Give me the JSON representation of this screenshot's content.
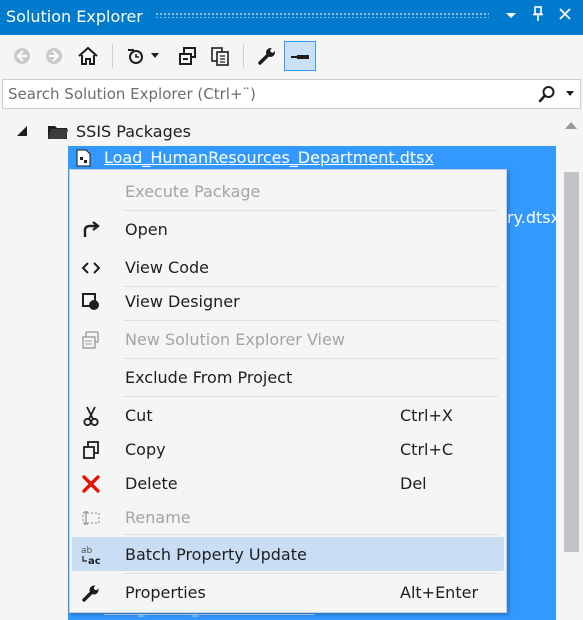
{
  "window": {
    "title": "Solution Explorer",
    "dropdown_icon": "dropdown-arrow-icon",
    "pin_icon": "pin-icon",
    "close_icon": "close-icon"
  },
  "toolbar": {
    "buttons": [
      "back-icon",
      "forward-icon",
      "home-icon",
      "pending-changes-icon",
      "collapse-all-icon",
      "show-all-files-icon",
      "properties-wrench-icon",
      "preview-selected-icon"
    ]
  },
  "search": {
    "placeholder": "Search Solution Explorer (Ctrl+¨)",
    "value": ""
  },
  "tree": {
    "root": {
      "label": "SSIS Packages",
      "icon": "folder-icon"
    },
    "selected_item": {
      "label": "Load_HumanResources_Department.dtsx",
      "icon": "package-file-icon"
    },
    "partial_right": "ry.dtsx",
    "partial_bottom": "Load_Person_Person.Plan.dtsx"
  },
  "context_menu": {
    "items": [
      {
        "label": "Execute Package",
        "shortcut": "",
        "icon": "",
        "disabled": true
      },
      {
        "label": "Open",
        "shortcut": "",
        "icon": "open-arrow-icon",
        "disabled": false
      },
      {
        "label": "View Code",
        "shortcut": "",
        "icon": "code-brackets-icon",
        "disabled": false
      },
      {
        "label": "View Designer",
        "shortcut": "",
        "icon": "designer-icon",
        "disabled": false
      },
      {
        "label": "New Solution Explorer View",
        "shortcut": "",
        "icon": "new-view-icon",
        "disabled": true
      },
      {
        "label": "Exclude From Project",
        "shortcut": "",
        "icon": "",
        "disabled": false
      },
      {
        "label": "Cut",
        "shortcut": "Ctrl+X",
        "icon": "scissors-icon",
        "disabled": false
      },
      {
        "label": "Copy",
        "shortcut": "Ctrl+C",
        "icon": "copy-icon",
        "disabled": false
      },
      {
        "label": "Delete",
        "shortcut": "Del",
        "icon": "delete-x-icon",
        "disabled": false
      },
      {
        "label": "Rename",
        "shortcut": "",
        "icon": "rename-icon",
        "disabled": true
      },
      {
        "label": "Batch Property Update",
        "shortcut": "",
        "icon": "batch-update-icon",
        "disabled": false,
        "highlighted": true
      },
      {
        "label": "Properties",
        "shortcut": "Alt+Enter",
        "icon": "wrench-icon",
        "disabled": false
      }
    ]
  },
  "colors": {
    "accent": "#007acc",
    "selection": "#3399ff",
    "menu_highlight": "#c9def5",
    "delete_red": "#e51400"
  }
}
